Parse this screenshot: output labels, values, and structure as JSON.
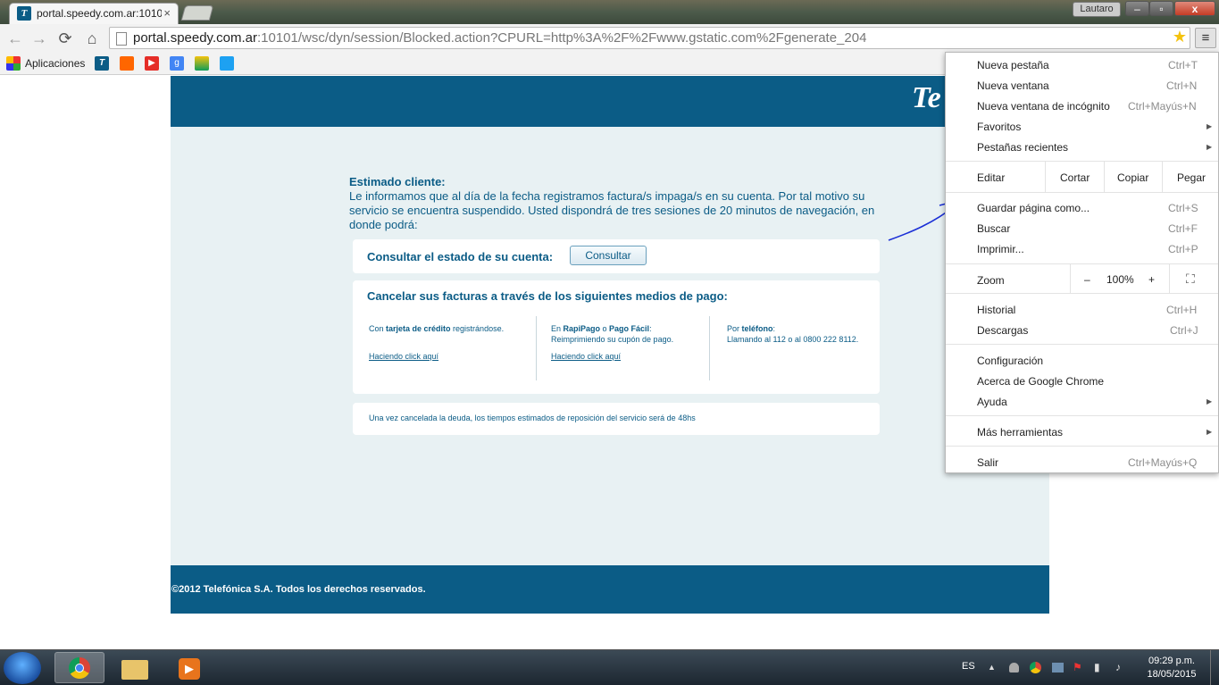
{
  "tab": {
    "title": "portal.speedy.com.ar:1010",
    "close": "×"
  },
  "window": {
    "user": "Lautaro",
    "min": "–",
    "max": "▫",
    "close": "x"
  },
  "toolbar": {
    "back": "←",
    "forward": "→",
    "reload": "⟳",
    "home": "⌂",
    "url_host": "portal.speedy.com.ar",
    "url_rest": ":10101/wsc/dyn/session/Blocked.action?CPURL=http%3A%2F%2Fwww.gstatic.com%2Fgenerate_204",
    "star": "★",
    "menu": "≡"
  },
  "bookmarks": {
    "apps_label": "Aplicaciones"
  },
  "page": {
    "logo": "Te",
    "heading": "Estimado cliente:",
    "body": "Le informamos que al día de la fecha registramos factura/s impaga/s en su cuenta. Por tal motivo su servicio se encuentra suspendido. Usted dispondrá de tres sesiones de 20 minutos de navegación, en donde podrá:",
    "consultar_label": "Consultar el estado de su cuenta:",
    "consultar_button": "Consultar",
    "pago_title": "Cancelar sus facturas a través de los siguientes medios de pago:",
    "col1_pre": "Con ",
    "col1_bold": "tarjeta de crédito",
    "col1_post": " registrándose.",
    "col1_link": "Haciendo click aquí",
    "col2_pre": "En ",
    "col2_bold1": "RapiPago",
    "col2_mid": " o ",
    "col2_bold2": "Pago Fácil",
    "col2_post": ":",
    "col2_line2": "Reimprimiendo su cupón de pago.",
    "col2_link": "Haciendo click aquí",
    "col3_pre": "Por ",
    "col3_bold": "teléfono",
    "col3_post": ":",
    "col3_line2": "Llamando al 112 o al 0800 222 8112.",
    "deuda_text": "Una vez cancelada la deuda, los tiempos estimados de reposición del servicio será de 48hs",
    "footer": "©2012 Telefónica S.A. Todos los derechos reservados."
  },
  "menu": {
    "new_tab": "Nueva pestaña",
    "new_tab_sc": "Ctrl+T",
    "new_window": "Nueva ventana",
    "new_window_sc": "Ctrl+N",
    "incognito": "Nueva ventana de incógnito",
    "incognito_sc": "Ctrl+Mayús+N",
    "bookmarks": "Favoritos",
    "recent_tabs": "Pestañas recientes",
    "edit": "Editar",
    "cut": "Cortar",
    "copy": "Copiar",
    "paste": "Pegar",
    "save_as": "Guardar página como...",
    "save_as_sc": "Ctrl+S",
    "find": "Buscar",
    "find_sc": "Ctrl+F",
    "print": "Imprimir...",
    "print_sc": "Ctrl+P",
    "zoom": "Zoom",
    "zoom_minus": "–",
    "zoom_value": "100%",
    "zoom_plus": "+",
    "fullscreen": "⛶",
    "history": "Historial",
    "history_sc": "Ctrl+H",
    "downloads": "Descargas",
    "downloads_sc": "Ctrl+J",
    "settings": "Configuración",
    "about": "Acerca de Google Chrome",
    "help": "Ayuda",
    "more_tools": "Más herramientas",
    "exit": "Salir",
    "exit_sc": "Ctrl+Mayús+Q",
    "arrow": "▶"
  },
  "taskbar": {
    "lang": "ES",
    "time": "09:29 p.m.",
    "date": "18/05/2015",
    "media_glyph": "▶",
    "tray_up": "▲",
    "tray_flag": "⚑",
    "tray_signal": "▮",
    "tray_volume": "♪"
  },
  "colors": {
    "brand": "#0b5c86",
    "page_bg": "#e8f1f3",
    "annotation": "#1a2fd6"
  }
}
